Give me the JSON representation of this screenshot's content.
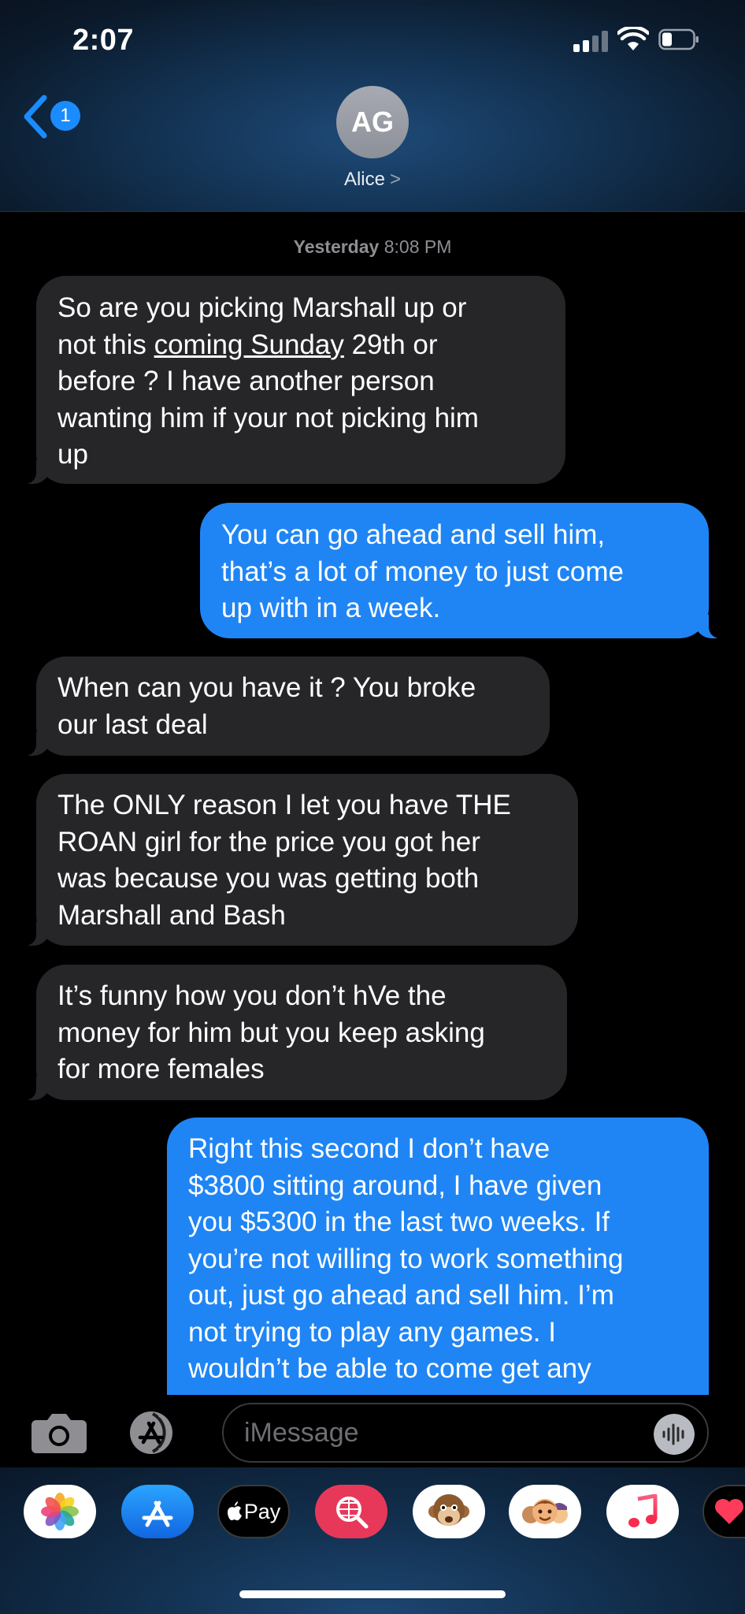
{
  "status_bar": {
    "time": "2:07"
  },
  "nav": {
    "back_badge": "1",
    "avatar_initials": "AG",
    "contact_name": "Alice",
    "contact_chevron": ">"
  },
  "timestamp": {
    "day": "Yesterday",
    "time": "8:08 PM"
  },
  "messages": [
    {
      "direction": "incoming",
      "lines": [
        "So are you picking Marshall up or",
        "",
        "before  ? I have another person",
        "wanting him if your not picking him",
        "up"
      ],
      "line2": {
        "pre": "not this ",
        "link": "coming Sunday",
        "post": " 29th or"
      }
    },
    {
      "direction": "outgoing",
      "lines": [
        "You can go ahead and sell him,",
        "that’s a lot of money to just come",
        "up with in a week."
      ]
    },
    {
      "direction": "incoming",
      "lines": [
        "When can you have it ? You broke",
        "our last deal"
      ]
    },
    {
      "direction": "incoming",
      "lines": [
        "The ONLY reason I let you have THE",
        "ROAN girl for the price you got her",
        "was because you was getting both",
        "Marshall and Bash"
      ]
    },
    {
      "direction": "incoming",
      "lines": [
        "It’s funny how you don’t hVe the",
        "money for him but you keep asking",
        "for more females"
      ]
    },
    {
      "direction": "outgoing",
      "lines": [
        "Right this second I don’t have",
        "$3800 sitting around, I have given",
        "you $5300 in the last two weeks. If",
        "you’re not willing to work something",
        "out, just go ahead and sell him. I’m",
        "not trying to play any games. I",
        "wouldn’t be able to come get any"
      ]
    }
  ],
  "input": {
    "placeholder": "iMessage"
  },
  "app_drawer": [
    {
      "name": "photos-app-icon"
    },
    {
      "name": "app-store-icon"
    },
    {
      "name": "apple-pay-icon",
      "label": "Pay"
    },
    {
      "name": "web-search-icon"
    },
    {
      "name": "monkey-animoji-icon"
    },
    {
      "name": "memoji-icon"
    },
    {
      "name": "music-app-icon"
    },
    {
      "name": "digital-touch-icon"
    }
  ],
  "colors": {
    "incoming_bubble": "#262629",
    "outgoing_bubble": "#1f85f5",
    "accent": "#1a8cff"
  }
}
